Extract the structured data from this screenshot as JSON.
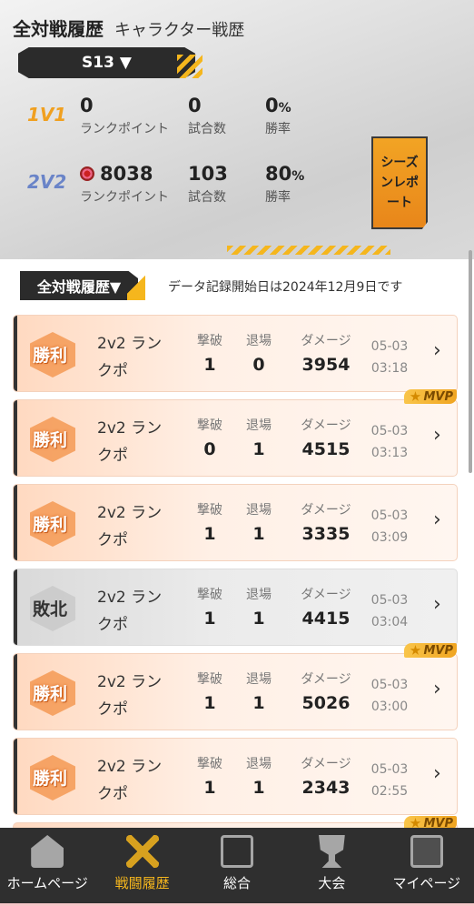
{
  "header": {
    "tab_active": "全対戦履歴",
    "tab_other": "キャラクター戦歴",
    "season": "S13"
  },
  "modes": [
    {
      "label": "1V1",
      "rank_points": "0",
      "rank_points_label": "ランクポイント",
      "matches": "0",
      "matches_label": "試合数",
      "win_rate": "0",
      "win_rate_unit": "%",
      "win_rate_label": "勝率"
    },
    {
      "label": "2V2",
      "rank_points": "8038",
      "rank_points_label": "ランクポイント",
      "matches": "103",
      "matches_label": "試合数",
      "win_rate": "80",
      "win_rate_unit": "%",
      "win_rate_label": "勝率"
    }
  ],
  "season_report": "シーズンレポート",
  "filter": {
    "label": "全対戦履歴▼"
  },
  "record_note": "データ記録開始日は2024年12月9日です",
  "columns": {
    "kills": "撃破",
    "deaths": "退場",
    "damage": "ダメージ"
  },
  "matches": [
    {
      "result": "勝利",
      "type": "2v2 ランクポ",
      "kills": "1",
      "deaths": "0",
      "damage": "3954",
      "date": "05-03",
      "time": "03:18",
      "mvp": false
    },
    {
      "result": "勝利",
      "type": "2v2 ランクポ",
      "kills": "0",
      "deaths": "1",
      "damage": "4515",
      "date": "05-03",
      "time": "03:13",
      "mvp": true
    },
    {
      "result": "勝利",
      "type": "2v2 ランクポ",
      "kills": "1",
      "deaths": "1",
      "damage": "3335",
      "date": "05-03",
      "time": "03:09",
      "mvp": false
    },
    {
      "result": "敗北",
      "type": "2v2 ランクポ",
      "kills": "1",
      "deaths": "1",
      "damage": "4415",
      "date": "05-03",
      "time": "03:04",
      "mvp": false
    },
    {
      "result": "勝利",
      "type": "2v2 ランクポ",
      "kills": "1",
      "deaths": "1",
      "damage": "5026",
      "date": "05-03",
      "time": "03:00",
      "mvp": true
    },
    {
      "result": "勝利",
      "type": "2v2 ランクポ",
      "kills": "1",
      "deaths": "1",
      "damage": "2343",
      "date": "05-03",
      "time": "02:55",
      "mvp": false
    }
  ],
  "mvp_label": "MVP",
  "nav": [
    {
      "label": "ホームページ",
      "icon": "home-icon"
    },
    {
      "label": "戦闘履歴",
      "icon": "crossed-swords-icon"
    },
    {
      "label": "総合",
      "icon": "device-icon"
    },
    {
      "label": "大会",
      "icon": "trophy-icon"
    },
    {
      "label": "マイページ",
      "icon": "profile-card-icon"
    }
  ],
  "colors": {
    "accent": "#f5b61d",
    "win": "#f4954c",
    "nav_bg": "#2f2f2f"
  }
}
